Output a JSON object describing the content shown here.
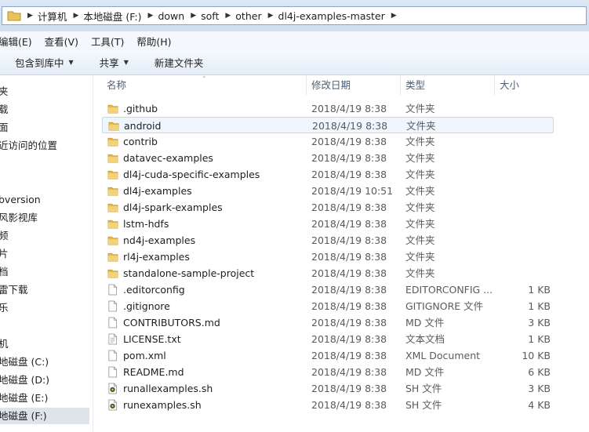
{
  "address": {
    "crumbs": [
      "计算机",
      "本地磁盘 (F:)",
      "down",
      "soft",
      "other",
      "dl4j-examples-master"
    ]
  },
  "menu": [
    "编辑(E)",
    "查看(V)",
    "工具(T)",
    "帮助(H)"
  ],
  "commands": {
    "include_library": "包含到库中",
    "share": "共享",
    "new_folder": "新建文件夹"
  },
  "nav": [
    {
      "label": "夹",
      "selected": false
    },
    {
      "label": "载",
      "selected": false
    },
    {
      "label": "面",
      "selected": false
    },
    {
      "label": "近访问的位置",
      "selected": false
    },
    {
      "label": "bversion",
      "selected": false
    },
    {
      "label": "风影视库",
      "selected": false
    },
    {
      "label": "频",
      "selected": false
    },
    {
      "label": "片",
      "selected": false
    },
    {
      "label": "档",
      "selected": false
    },
    {
      "label": "雷下载",
      "selected": false
    },
    {
      "label": "乐",
      "selected": false
    },
    {
      "label": "机",
      "selected": false
    },
    {
      "label": "地磁盘 (C:)",
      "selected": false
    },
    {
      "label": "地磁盘 (D:)",
      "selected": false
    },
    {
      "label": "地磁盘 (E:)",
      "selected": false
    },
    {
      "label": "地磁盘 (F:)",
      "selected": true
    }
  ],
  "columns": {
    "name": "名称",
    "date": "修改日期",
    "type": "类型",
    "size": "大小"
  },
  "files": [
    {
      "name": ".github",
      "date": "2018/4/19 8:38",
      "type": "文件夹",
      "size": "",
      "icon": "folder"
    },
    {
      "name": "android",
      "date": "2018/4/19 8:38",
      "type": "文件夹",
      "size": "",
      "icon": "folder"
    },
    {
      "name": "contrib",
      "date": "2018/4/19 8:38",
      "type": "文件夹",
      "size": "",
      "icon": "folder"
    },
    {
      "name": "datavec-examples",
      "date": "2018/4/19 8:38",
      "type": "文件夹",
      "size": "",
      "icon": "folder"
    },
    {
      "name": "dl4j-cuda-specific-examples",
      "date": "2018/4/19 8:38",
      "type": "文件夹",
      "size": "",
      "icon": "folder"
    },
    {
      "name": "dl4j-examples",
      "date": "2018/4/19 10:51",
      "type": "文件夹",
      "size": "",
      "icon": "folder"
    },
    {
      "name": "dl4j-spark-examples",
      "date": "2018/4/19 8:38",
      "type": "文件夹",
      "size": "",
      "icon": "folder"
    },
    {
      "name": "lstm-hdfs",
      "date": "2018/4/19 8:38",
      "type": "文件夹",
      "size": "",
      "icon": "folder"
    },
    {
      "name": "nd4j-examples",
      "date": "2018/4/19 8:38",
      "type": "文件夹",
      "size": "",
      "icon": "folder"
    },
    {
      "name": "rl4j-examples",
      "date": "2018/4/19 8:38",
      "type": "文件夹",
      "size": "",
      "icon": "folder"
    },
    {
      "name": "standalone-sample-project",
      "date": "2018/4/19 8:38",
      "type": "文件夹",
      "size": "",
      "icon": "folder"
    },
    {
      "name": ".editorconfig",
      "date": "2018/4/19 8:38",
      "type": "EDITORCONFIG ...",
      "size": "1 KB",
      "icon": "file"
    },
    {
      "name": ".gitignore",
      "date": "2018/4/19 8:38",
      "type": "GITIGNORE 文件",
      "size": "1 KB",
      "icon": "file"
    },
    {
      "name": "CONTRIBUTORS.md",
      "date": "2018/4/19 8:38",
      "type": "MD 文件",
      "size": "3 KB",
      "icon": "file"
    },
    {
      "name": "LICENSE.txt",
      "date": "2018/4/19 8:38",
      "type": "文本文档",
      "size": "1 KB",
      "icon": "text-file"
    },
    {
      "name": "pom.xml",
      "date": "2018/4/19 8:38",
      "type": "XML Document",
      "size": "10 KB",
      "icon": "file"
    },
    {
      "name": "README.md",
      "date": "2018/4/19 8:38",
      "type": "MD 文件",
      "size": "6 KB",
      "icon": "file"
    },
    {
      "name": "runallexamples.sh",
      "date": "2018/4/19 8:38",
      "type": "SH 文件",
      "size": "3 KB",
      "icon": "script-file"
    },
    {
      "name": "runexamples.sh",
      "date": "2018/4/19 8:38",
      "type": "SH 文件",
      "size": "4 KB",
      "icon": "script-file"
    }
  ],
  "hovered_row": 1
}
